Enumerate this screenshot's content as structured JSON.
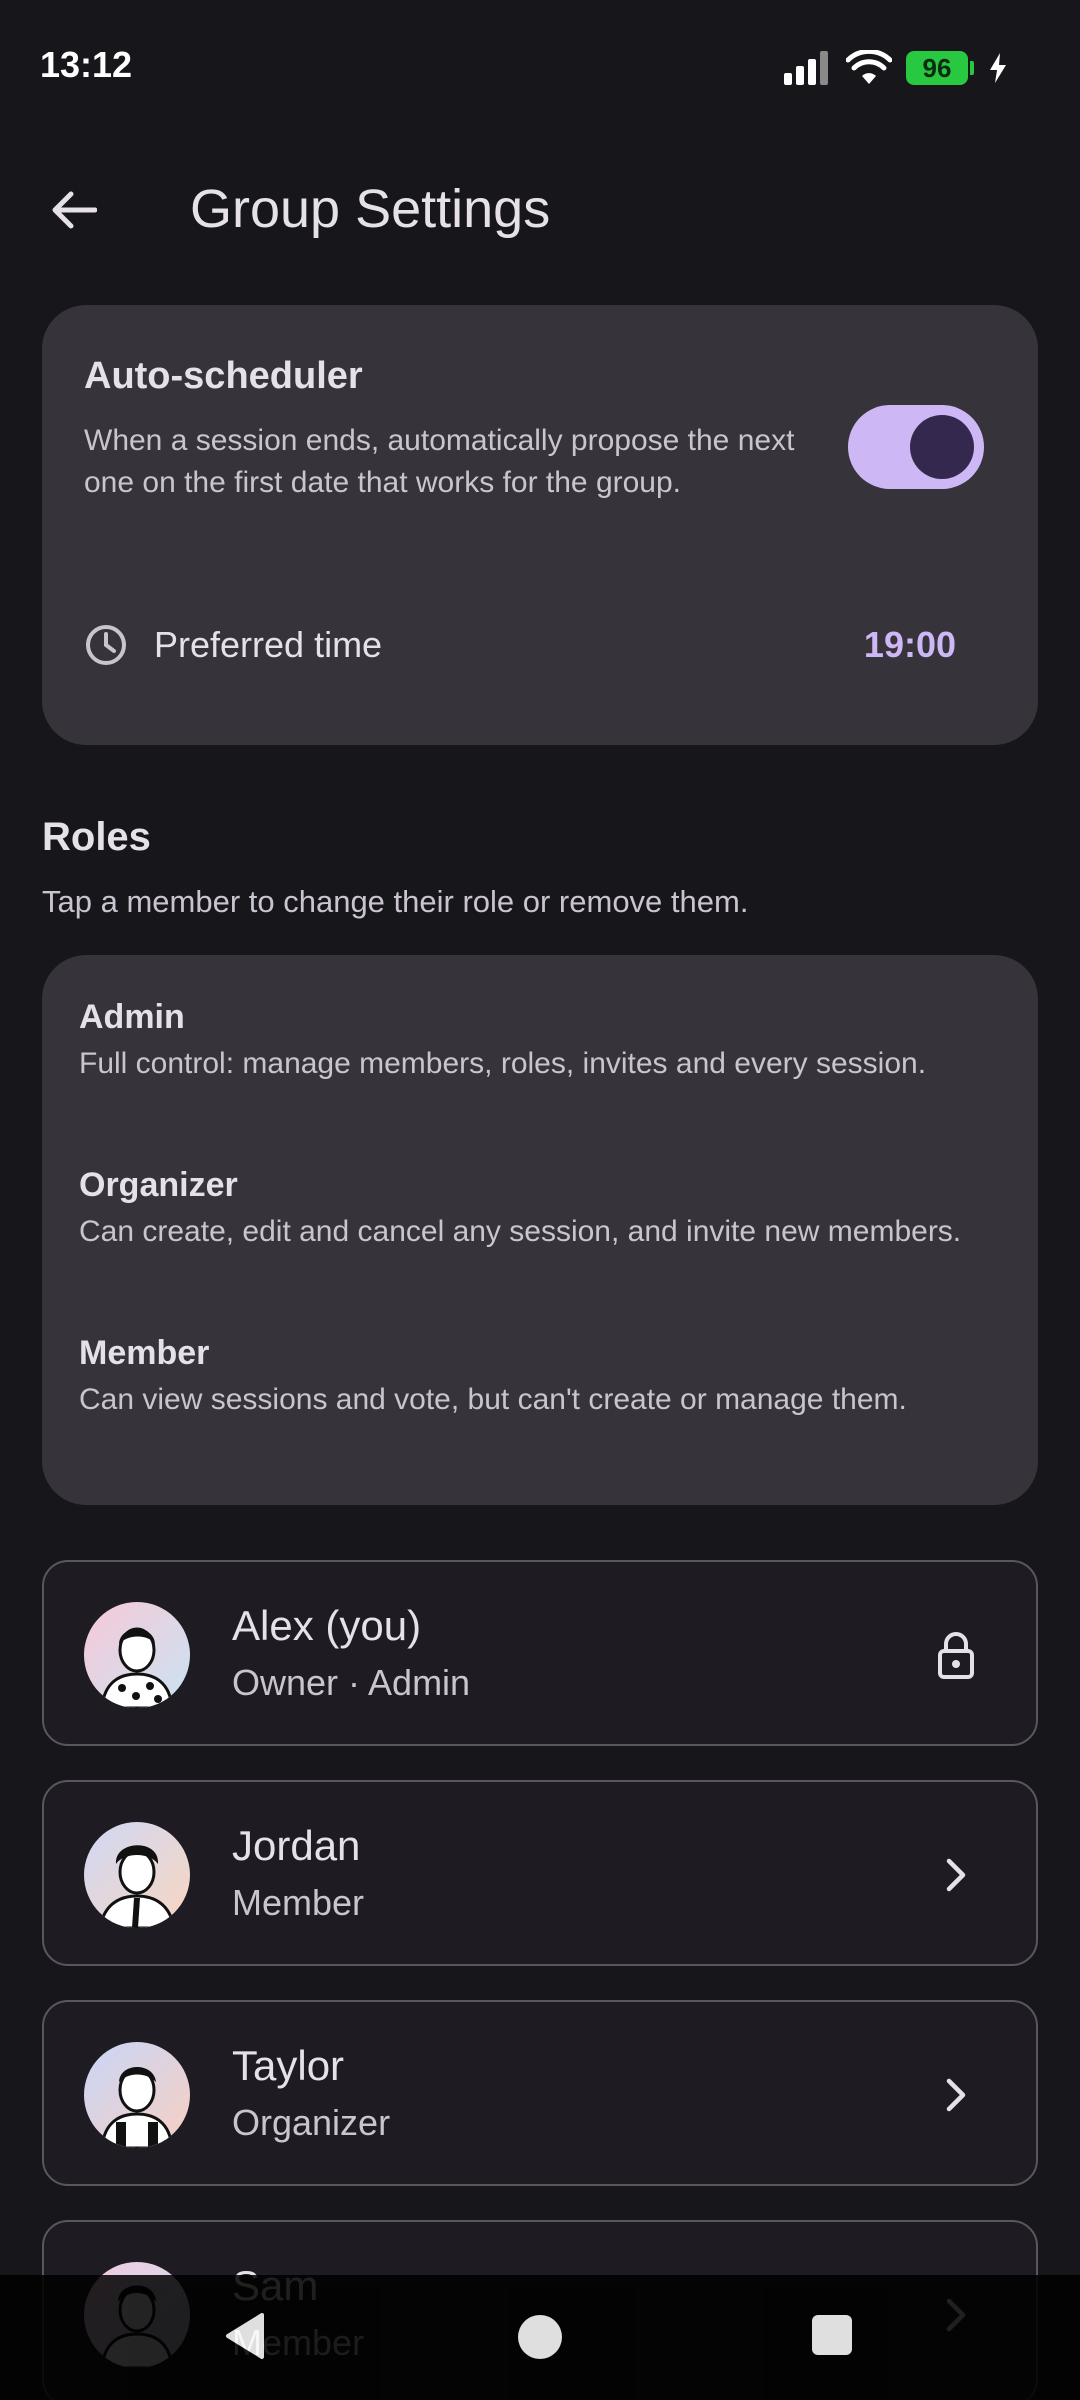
{
  "status_bar": {
    "time": "13:12",
    "battery": "96"
  },
  "app_bar": {
    "title": "Group Settings"
  },
  "auto_scheduler": {
    "title": "Auto-scheduler",
    "description": "When a session ends, automatically propose the next one on the first date that works for the group.",
    "enabled": true,
    "preferred_time_label": "Preferred time",
    "preferred_time_value": "19:00"
  },
  "roles": {
    "heading": "Roles",
    "subtitle": "Tap a member to change their role or remove them.",
    "items": [
      {
        "name": "Admin",
        "description": "Full control: manage members, roles, invites and every session."
      },
      {
        "name": "Organizer",
        "description": "Can create, edit and cancel any session, and invite new members."
      },
      {
        "name": "Member",
        "description": "Can view sessions and vote, but can't create or manage them."
      }
    ]
  },
  "members": [
    {
      "name": "Alex (you)",
      "role": "Owner · Admin",
      "action_icon": "lock-icon"
    },
    {
      "name": "Jordan",
      "role": "Member",
      "action_icon": "chevron-right-icon"
    },
    {
      "name": "Taylor",
      "role": "Organizer",
      "action_icon": "chevron-right-icon"
    },
    {
      "name": "Sam",
      "role": "Member",
      "action_icon": "chevron-right-icon"
    }
  ],
  "colors": {
    "accent": "#cdb8f5",
    "toggle_knob": "#34284f",
    "battery": "#28c840",
    "surface": "#36333b",
    "background": "#17161b"
  }
}
